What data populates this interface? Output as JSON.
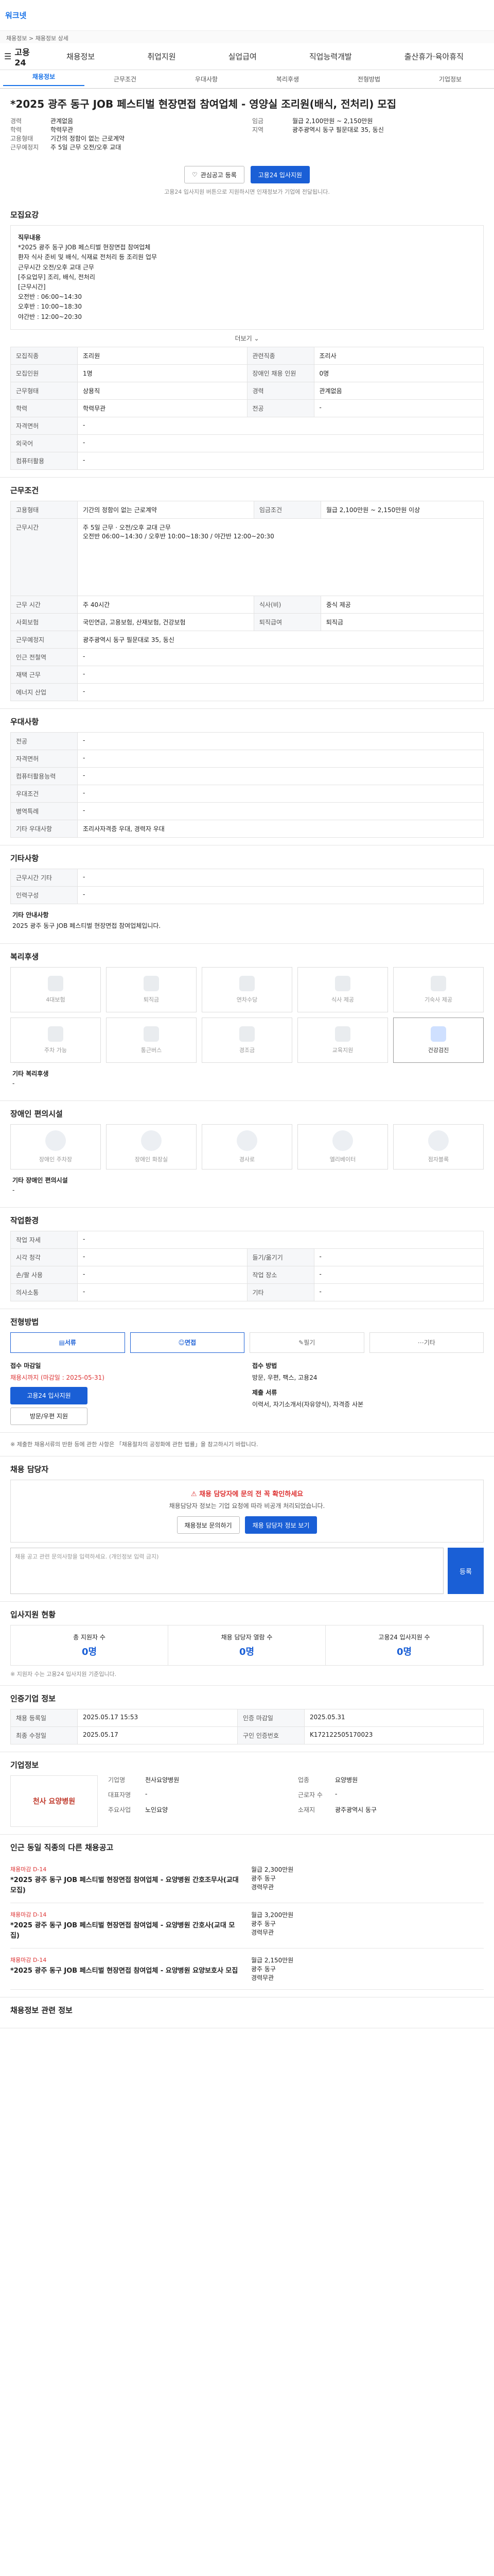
{
  "top": {
    "brand": "워크넷",
    "notice": "채용정보 > 채용정보 상세"
  },
  "gnb": {
    "logo": "고용24",
    "menu": [
      "채용정보",
      "취업지원",
      "실업급여",
      "직업능력개발",
      "출산휴가·육아휴직"
    ]
  },
  "tabs": [
    "채용정보",
    "근무조건",
    "우대사항",
    "복리후생",
    "전형방법",
    "기업정보"
  ],
  "job": {
    "title": "*2025 광주 동구 JOB 페스티벌 현장면접 참여업체 - 영양실 조리원(배식, 전처리) 모집",
    "left": [
      {
        "k": "경력",
        "v": "관계없음"
      },
      {
        "k": "학력",
        "v": "학력무관"
      },
      {
        "k": "고용형태",
        "v": ""
      },
      {
        "k": "고용형태",
        "v": "기간의 정함이 없는 근로계약"
      },
      {
        "k": "근무예정지",
        "v": "주 5일 근무 오전/오후 교대"
      }
    ],
    "right": [
      {
        "k": "임금",
        "v": "월급 2,100만원 ~ 2,150만원"
      },
      {
        "k": "지역",
        "v": "광주광역시 동구 필문대로 35, 동신"
      },
      {
        "k": "채용기간",
        "v": ""
      }
    ],
    "btn_scrap": "관심공고 등록",
    "btn_apply": "고용24 입사지원",
    "apply_note": "고용24 입사지원 버튼으로 지원하시면 인재정보가 기업에 전달됩니다."
  },
  "recruit": {
    "title": "모집요강",
    "content_label": "직무내용",
    "content": "*2025 광주 동구 JOB 페스티벌 현장면접 참여업체\n환자 식사 준비 및 배식, 식재료 전처리 등 조리원 업무\n근무시간 오전/오후 교대 근무\n[주요업무] 조리, 배식, 전처리\n[근무시간]\n오전반 : 06:00~14:30\n오후반 : 10:00~18:30\n야간반 : 12:00~20:30",
    "more": "더보기",
    "rows": [
      {
        "k": "모집직종",
        "v": "조리원",
        "k2": "관련직종",
        "v2": "조리사"
      },
      {
        "k": "모집인원",
        "v": "1명",
        "k2": "장애인 채용 인원",
        "v2": "0명"
      },
      {
        "k": "근무형태",
        "v": "상용직",
        "k2": "경력",
        "v2": "관계없음"
      },
      {
        "k": "학력",
        "v": "학력무관",
        "k2": "전공",
        "v2": "-"
      },
      {
        "k": "자격면허",
        "v": "-",
        "k2": "",
        "v2": ""
      },
      {
        "k": "외국어",
        "v": "-",
        "k2": "",
        "v2": ""
      },
      {
        "k": "컴퓨터활용",
        "v": "-",
        "k2": "",
        "v2": ""
      }
    ]
  },
  "conditions": {
    "title": "근무조건",
    "rows": [
      {
        "k": "고용형태",
        "v": "기간의 정함이 없는 근로계약",
        "k2": "임금조건",
        "v2": "월급 2,100만원 ~ 2,150만원 이상"
      },
      {
        "k": "근무시간",
        "v": "주 5일 근무 · 오전/오후 교대 근무\n오전반 06:00~14:30 / 오후반 10:00~18:30 / 야간반 12:00~20:30"
      },
      {
        "k": "근무 시간",
        "v": "주 40시간",
        "k2": "식사(비)",
        "v2": "중식 제공"
      },
      {
        "k": "사회보험",
        "v": "국민연금, 고용보험, 산재보험, 건강보험",
        "k2": "퇴직급여",
        "v2": "퇴직금"
      },
      {
        "k": "근무예정지",
        "v": "광주광역시 동구 필문대로 35, 동신",
        "k2": "",
        "v2": ""
      },
      {
        "k": "인근 전철역",
        "v": "-",
        "k2": "",
        "v2": ""
      },
      {
        "k": "재택 근무",
        "v": "-",
        "k2": "",
        "v2": ""
      },
      {
        "k": "에너지 산업",
        "v": "-",
        "k2": "",
        "v2": ""
      }
    ]
  },
  "pref": {
    "title": "우대사항",
    "rows": [
      {
        "k": "전공",
        "v": "-"
      },
      {
        "k": "자격면허",
        "v": "-"
      },
      {
        "k": "컴퓨터활용능력",
        "v": "-"
      },
      {
        "k": "우대조건",
        "v": "-"
      },
      {
        "k": "병역특례",
        "v": "-"
      },
      {
        "k": "기타 우대사항",
        "v": "조리사자격증 우대, 경력자 우대"
      }
    ]
  },
  "etc": {
    "title": "기타사항",
    "rows": [
      {
        "k": "근무시간 기타",
        "v": "-"
      },
      {
        "k": "인력구성",
        "v": "-"
      }
    ],
    "memo_label": "기타 안내사항",
    "memo": "2025 광주 동구 JOB 페스티벌 현장면접 참여업체입니다."
  },
  "benefits": {
    "title": "복리후생",
    "items": [
      {
        "label": "4대보험",
        "on": false
      },
      {
        "label": "퇴직금",
        "on": false
      },
      {
        "label": "연차수당",
        "on": false
      },
      {
        "label": "식사 제공",
        "on": false
      },
      {
        "label": "기숙사 제공",
        "on": false
      },
      {
        "label": "주차 가능",
        "on": false
      },
      {
        "label": "통근버스",
        "on": false
      },
      {
        "label": "경조금",
        "on": false
      },
      {
        "label": "교육지원",
        "on": false
      },
      {
        "label": "건강검진",
        "on": true
      }
    ],
    "other_label": "기타 복리후생",
    "other": "-"
  },
  "disabled": {
    "title": "장애인 편의시설",
    "items": [
      "장애인 주차장",
      "장애인 화장실",
      "경사로",
      "엘리베이터",
      "점자블록"
    ],
    "other_label": "기타 장애인 편의시설",
    "other": "-"
  },
  "env": {
    "title": "작업환경",
    "rows": [
      {
        "k": "작업 자세",
        "v": "-",
        "k2": "",
        "v2": ""
      },
      {
        "k": "시각 청각",
        "v": "-",
        "k2": "들기/옮기기",
        "v2": "-"
      },
      {
        "k": "손/팔 사용",
        "v": "-",
        "k2": "작업 장소",
        "v2": "-"
      },
      {
        "k": "의사소통",
        "v": "-",
        "k2": "기타",
        "v2": "-"
      }
    ]
  },
  "selection": {
    "title": "전형방법",
    "steps": [
      {
        "label": "서류",
        "on": true
      },
      {
        "label": "면접",
        "on": true
      },
      {
        "label": "필기",
        "on": false
      },
      {
        "label": "기타",
        "on": false
      }
    ],
    "apply_title": "접수 마감일",
    "deadline": "채용시까지 (마감일 : 2025-05-31)",
    "apply_btn": "고용24 입사지원",
    "offline_btn": "방문/우편 지원",
    "method_title": "접수 방법",
    "method": "방문, 우편, 팩스, 고용24",
    "docs_title": "제출 서류",
    "docs": "이력서, 자기소개서(자유양식), 자격증 사본"
  },
  "notice": "※ 제출한 채용서류의 반환 등에 관한 사항은 「채용절차의 공정화에 관한 법률」을 참고하시기 바랍니다.",
  "qna": {
    "title": "채용 담당자",
    "headline": "채용 담당자에 문의 전 꼭 확인하세요",
    "sub": "채용담당자 정보는 기업 요청에 따라 비공개 처리되었습니다.",
    "btn1": "채용정보 문의하기",
    "btn2": "채용 담당자 정보 보기",
    "placeholder": "채용 공고 관련 문의사항을 입력하세요. (개인정보 입력 금지)",
    "submit": "등록"
  },
  "stats": {
    "title": "입사지원 현황",
    "items": [
      {
        "label": "총 지원자 수",
        "value": "0명"
      },
      {
        "label": "채용 담당자 열람 수",
        "value": "0명"
      },
      {
        "label": "고용24 입사지원 수",
        "value": "0명"
      }
    ],
    "note": "※ 지원자 수는 고용24 입사지원 기준입니다."
  },
  "info": {
    "title": "인증기업 정보",
    "rows": [
      {
        "k": "채용 등록일",
        "v": "2025.05.17 15:53",
        "k2": "인증 마감일",
        "v2": "2025.05.31"
      },
      {
        "k": "최종 수정일",
        "v": "2025.05.17",
        "k2": "구인 인증번호",
        "v2": "K172122505170023"
      }
    ]
  },
  "company": {
    "title": "기업정보",
    "logo": "천사 요양병원",
    "rows": [
      {
        "k": "기업명",
        "v": "천사요양병원"
      },
      {
        "k": "업종",
        "v": "요양병원"
      },
      {
        "k": "대표자명",
        "v": "-"
      },
      {
        "k": "근로자 수",
        "v": "-"
      },
      {
        "k": "주요사업",
        "v": "노인요양"
      },
      {
        "k": "소재지",
        "v": "광주광역시 동구"
      }
    ]
  },
  "similar": {
    "title": "인근 동일 직종의 다른 채용공고",
    "jobs": [
      {
        "tag": "채용마감 D-14",
        "title": "*2025 광주 동구 JOB 페스티벌 현장면접 참여업체 - 요양병원 간호조무사(교대 모집)",
        "pay": "월급 2,300만원",
        "loc": "광주 동구",
        "career": "경력무관"
      },
      {
        "tag": "채용마감 D-14",
        "title": "*2025 광주 동구 JOB 페스티벌 현장면접 참여업체 - 요양병원 간호사(교대 모집)",
        "pay": "월급 3,200만원",
        "loc": "광주 동구",
        "career": "경력무관"
      },
      {
        "tag": "채용마감 D-14",
        "title": "*2025 광주 동구 JOB 페스티벌 현장면접 참여업체 - 요양병원 요양보호사 모집",
        "pay": "월급 2,150만원",
        "loc": "광주 동구",
        "career": "경력무관"
      }
    ]
  },
  "bottom": {
    "title": "채용정보 관련 정보"
  }
}
